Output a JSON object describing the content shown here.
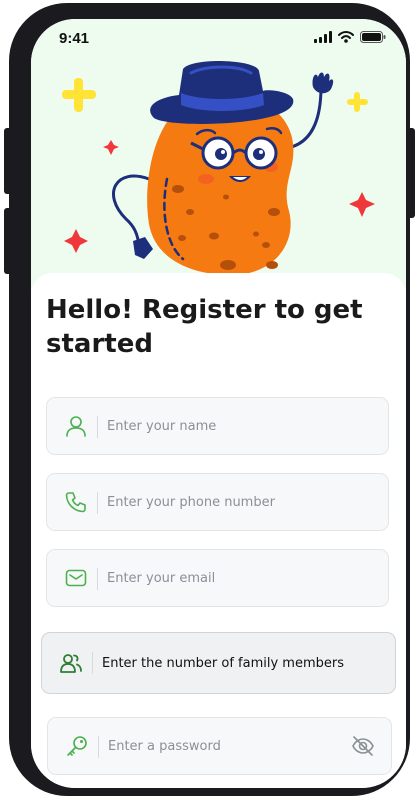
{
  "status_bar": {
    "time": "9:41"
  },
  "form": {
    "title": "Hello! Register to get started",
    "name_placeholder": "Enter your name",
    "phone_placeholder": "Enter your phone number",
    "email_placeholder": "Enter your email",
    "family_placeholder": "Enter the number of family members",
    "password_placeholder": "Enter a password"
  },
  "icons": {
    "name": "user-icon",
    "phone": "phone-icon",
    "email": "mail-icon",
    "family": "users-icon",
    "password": "key-icon",
    "visibility": "eye-off-icon"
  },
  "colors": {
    "hero_background": "#eefcef",
    "accent_green": "#4caf50",
    "mascot_orange": "#f57a12",
    "hat_navy": "#1d2e7a",
    "sparkle_yellow": "#ffe436",
    "sparkle_red": "#f0383a"
  }
}
